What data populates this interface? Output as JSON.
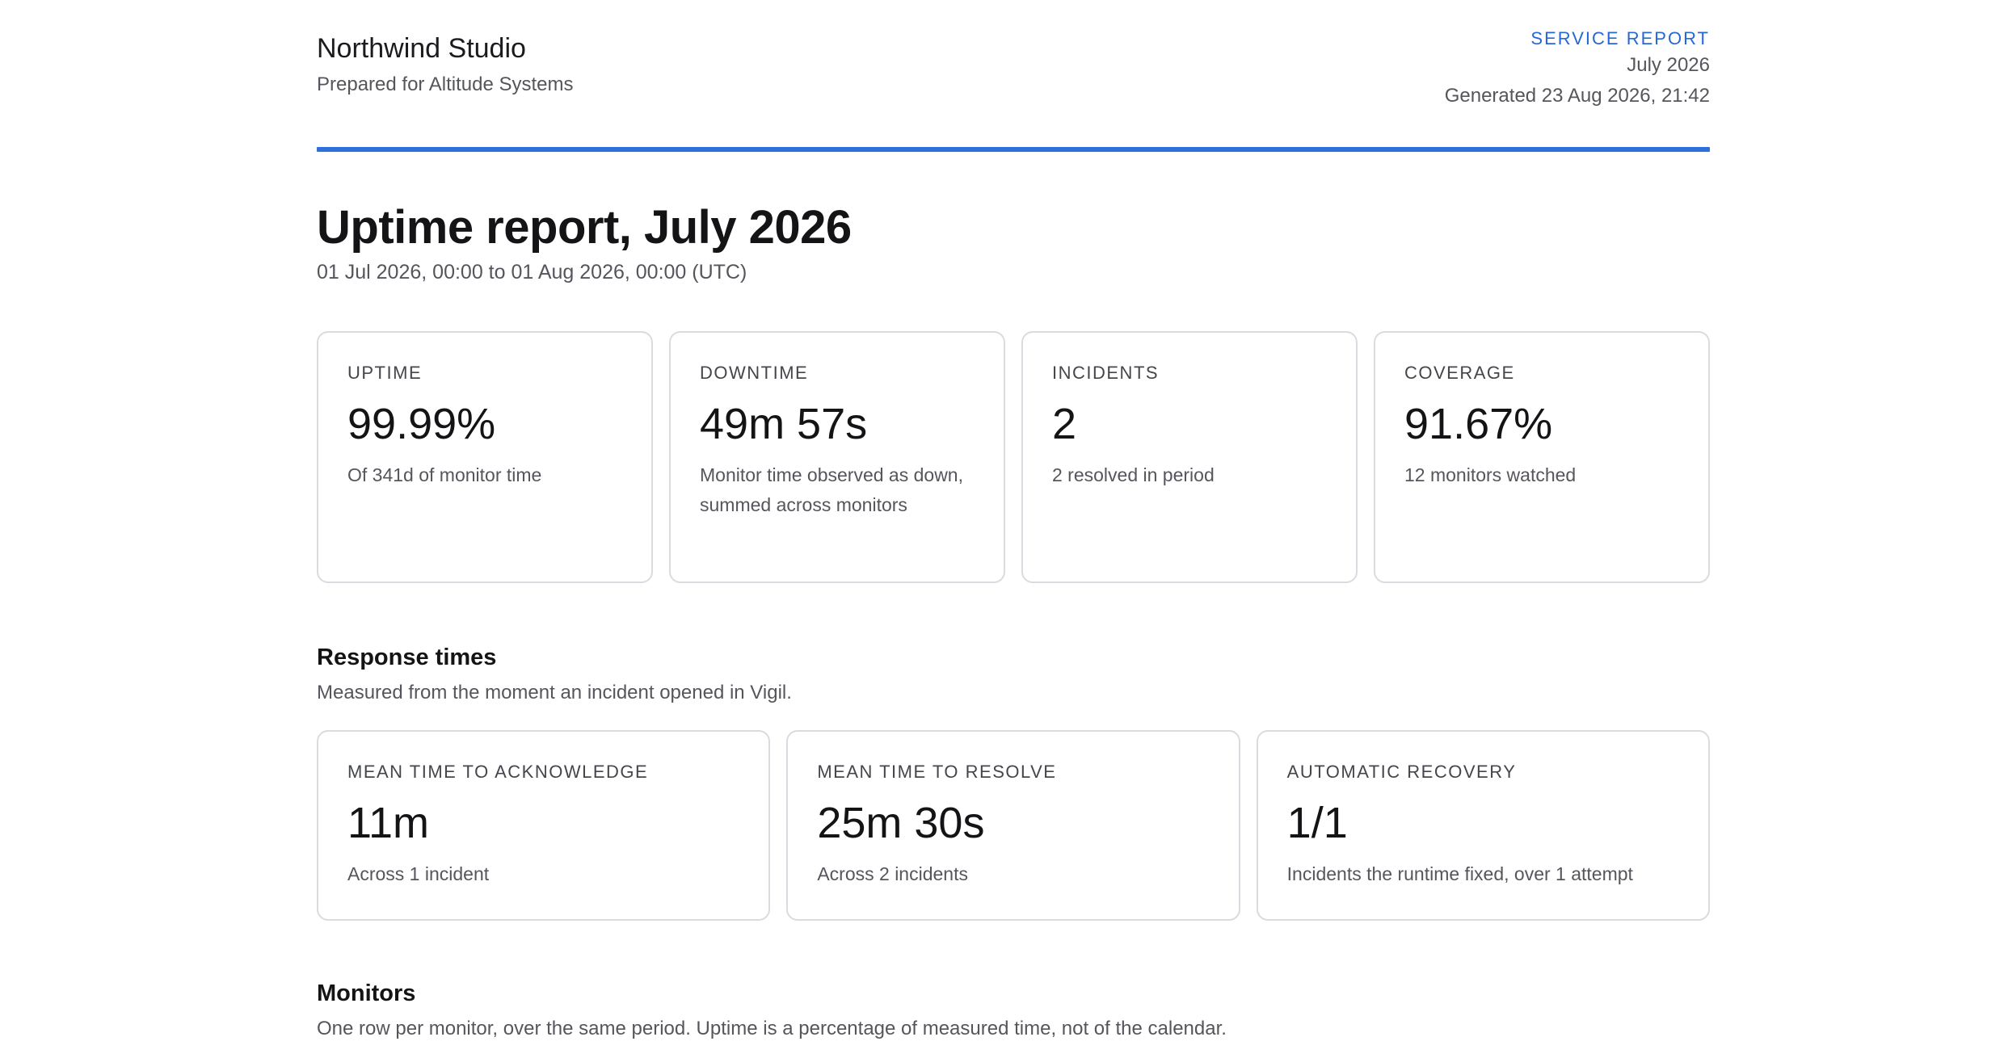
{
  "header": {
    "brand_name": "Northwind Studio",
    "prepared_for": "Prepared for Altitude Systems",
    "kicker": "SERVICE REPORT",
    "period_label": "July 2026",
    "generated": "Generated 23 Aug 2026, 21:42"
  },
  "report": {
    "title": "Uptime report, July 2026",
    "period": "01 Jul 2026, 00:00 to 01 Aug 2026, 00:00 (UTC)"
  },
  "summary_cards": [
    {
      "label": "UPTIME",
      "value": "99.99%",
      "note": "Of 341d of monitor time"
    },
    {
      "label": "DOWNTIME",
      "value": "49m 57s",
      "note": "Monitor time observed as down, summed across monitors"
    },
    {
      "label": "INCIDENTS",
      "value": "2",
      "note": "2 resolved in period"
    },
    {
      "label": "COVERAGE",
      "value": "91.67%",
      "note": "12 monitors watched"
    }
  ],
  "response_times": {
    "title": "Response times",
    "description": "Measured from the moment an incident opened in Vigil.",
    "cards": [
      {
        "label": "MEAN TIME TO ACKNOWLEDGE",
        "value": "11m",
        "note": "Across 1 incident"
      },
      {
        "label": "MEAN TIME TO RESOLVE",
        "value": "25m 30s",
        "note": "Across 2 incidents"
      },
      {
        "label": "AUTOMATIC RECOVERY",
        "value": "1/1",
        "note": "Incidents the runtime fixed, over 1 attempt"
      }
    ]
  },
  "monitors": {
    "title": "Monitors",
    "description": "One row per monitor, over the same period. Uptime is a percentage of measured time, not of the calendar."
  },
  "colors": {
    "accent": "#2f6fdc",
    "kicker": "#2568d6",
    "card_border": "#dadbe0",
    "muted_text": "#55565c"
  }
}
